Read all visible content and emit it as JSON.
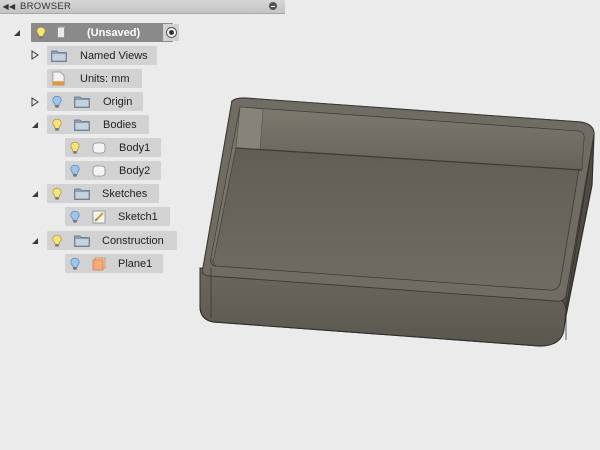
{
  "panel": {
    "title": "BROWSER",
    "collapse_icon": "double-chevron-left-icon",
    "pin_icon": "pin-icon"
  },
  "tree": {
    "root": {
      "label": "(Unsaved)",
      "icons": [
        "lightbulb-icon",
        "component-icon",
        "radio-active-icon"
      ]
    },
    "named_views": {
      "label": "Named Views",
      "icon": "folder-icon"
    },
    "units": {
      "label": "Units: mm",
      "icon": "document-units-icon"
    },
    "origin": {
      "label": "Origin",
      "icons": [
        "lightbulb-icon",
        "folder-icon"
      ]
    },
    "bodies": {
      "label": "Bodies",
      "icons": [
        "lightbulb-icon",
        "folder-icon"
      ]
    },
    "body1": {
      "label": "Body1",
      "icons": [
        "lightbulb-icon",
        "body-icon"
      ]
    },
    "body2": {
      "label": "Body2",
      "icons": [
        "lightbulb-icon",
        "body-icon"
      ]
    },
    "sketches": {
      "label": "Sketches",
      "icons": [
        "lightbulb-icon",
        "folder-icon"
      ]
    },
    "sketch1": {
      "label": "Sketch1",
      "icons": [
        "lightbulb-icon",
        "sketch-icon"
      ]
    },
    "construction": {
      "label": "Construction",
      "icons": [
        "lightbulb-icon",
        "folder-icon"
      ]
    },
    "plane1": {
      "label": "Plane1",
      "icons": [
        "lightbulb-icon",
        "plane-icon"
      ]
    }
  },
  "viewport": {
    "model": "open-tray-3d-model",
    "colors": {
      "background": "#ebebeb",
      "model_rim": "#5f5c52",
      "model_floor": "#6a675e"
    }
  }
}
